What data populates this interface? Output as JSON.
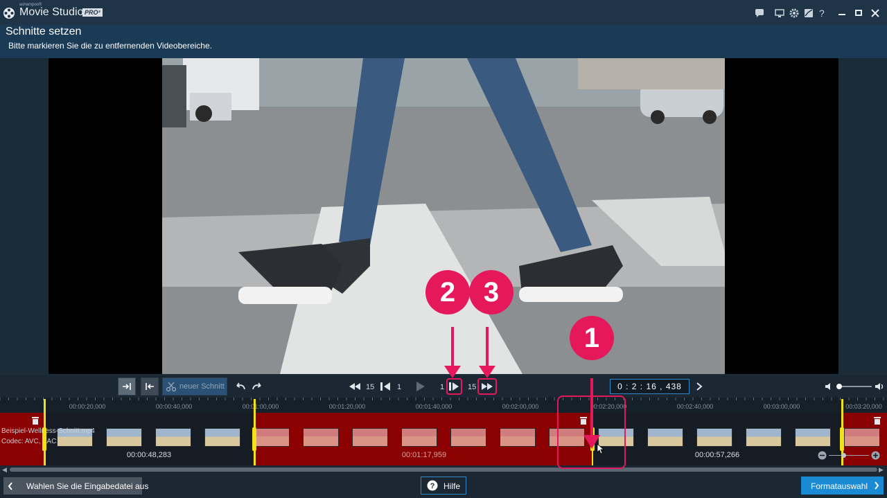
{
  "app": {
    "brand_small": "ashampoo®",
    "name": "Movie Studio",
    "edition": "PRO³"
  },
  "window_controls": {
    "help": "?"
  },
  "page": {
    "title": "Schnitte setzen",
    "subtitle": "Bitte markieren Sie die zu entfernenden Videobereiche."
  },
  "transport": {
    "new_cut_label": "neuer Schnitt",
    "rewind_frames": "15",
    "prev_frames": "1",
    "next_frames": "1",
    "forward_frames": "15",
    "timecode": "0 : 2 : 16 , 438"
  },
  "ruler": {
    "ticks": [
      "00:00:20,000",
      "00:00:40,000",
      "00:01:00,000",
      "00:01:20,000",
      "00:01:40,000",
      "00:02:00,000",
      "00:02:20,000",
      "00:02:40,000",
      "00:03:00,000",
      "00:03:20,000"
    ]
  },
  "track": {
    "file_name": "Beispiel-Wellness-Schnitt.mp4",
    "codec": "Codec: AVC, AAC",
    "durations": [
      "00:00:48,283",
      "00:01:17,959",
      "00:00:57,266"
    ]
  },
  "annotations": {
    "badge1": "1",
    "badge2": "2",
    "badge3": "3"
  },
  "footer": {
    "back_label": "Wahlen Sie die Eingabedatei aus",
    "help_label": "Hilfe",
    "next_label": "Formatauswahl"
  },
  "colors": {
    "accent": "#1a8ad4",
    "cut_red": "#8b0000",
    "marker_yellow": "#f2e01a",
    "annotation_pink": "#e5185c"
  }
}
